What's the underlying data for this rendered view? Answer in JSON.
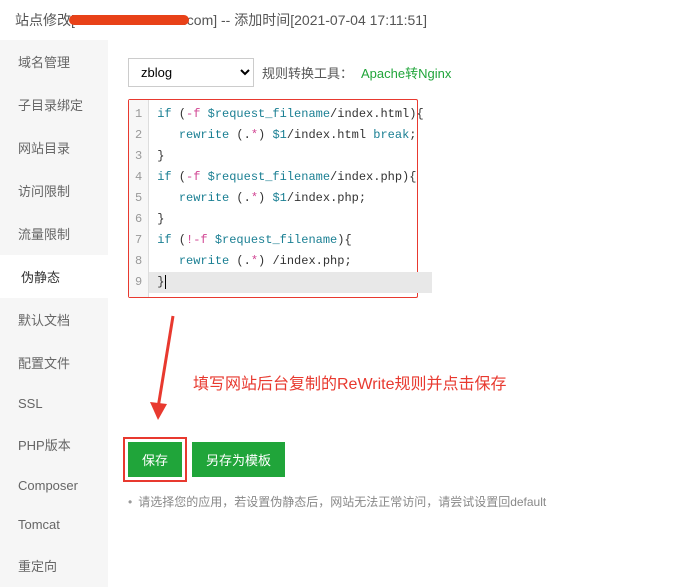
{
  "header": {
    "prefix": "站点修改[",
    "domain_suffix": ".com]",
    "time_label": " -- 添加时间[2021-07-04 17:11:51]"
  },
  "sidebar": {
    "items": [
      {
        "label": "域名管理"
      },
      {
        "label": "子目录绑定"
      },
      {
        "label": "网站目录"
      },
      {
        "label": "访问限制"
      },
      {
        "label": "流量限制"
      },
      {
        "label": "伪静态"
      },
      {
        "label": "默认文档"
      },
      {
        "label": "配置文件"
      },
      {
        "label": "SSL"
      },
      {
        "label": "PHP版本"
      },
      {
        "label": "Composer"
      },
      {
        "label": "Tomcat"
      },
      {
        "label": "重定向"
      }
    ],
    "active_index": 5
  },
  "toolbar": {
    "select_value": "zblog",
    "convert_label": "规则转换工具：",
    "convert_link": "Apache转Nginx"
  },
  "code_lines": [
    "if (-f $request_filename/index.html){",
    "   rewrite (.*) $1/index.html break;",
    "}",
    "if (-f $request_filename/index.php){",
    "   rewrite (.*) $1/index.php;",
    "}",
    "if (!-f $request_filename){",
    "   rewrite (.*) /index.php;",
    "}"
  ],
  "annotation": {
    "text": "填写网站后台复制的ReWrite规则并点击保存"
  },
  "buttons": {
    "save": "保存",
    "save_template": "另存为模板"
  },
  "hint": "请选择您的应用，若设置伪静态后，网站无法正常访问，请尝试设置回default"
}
